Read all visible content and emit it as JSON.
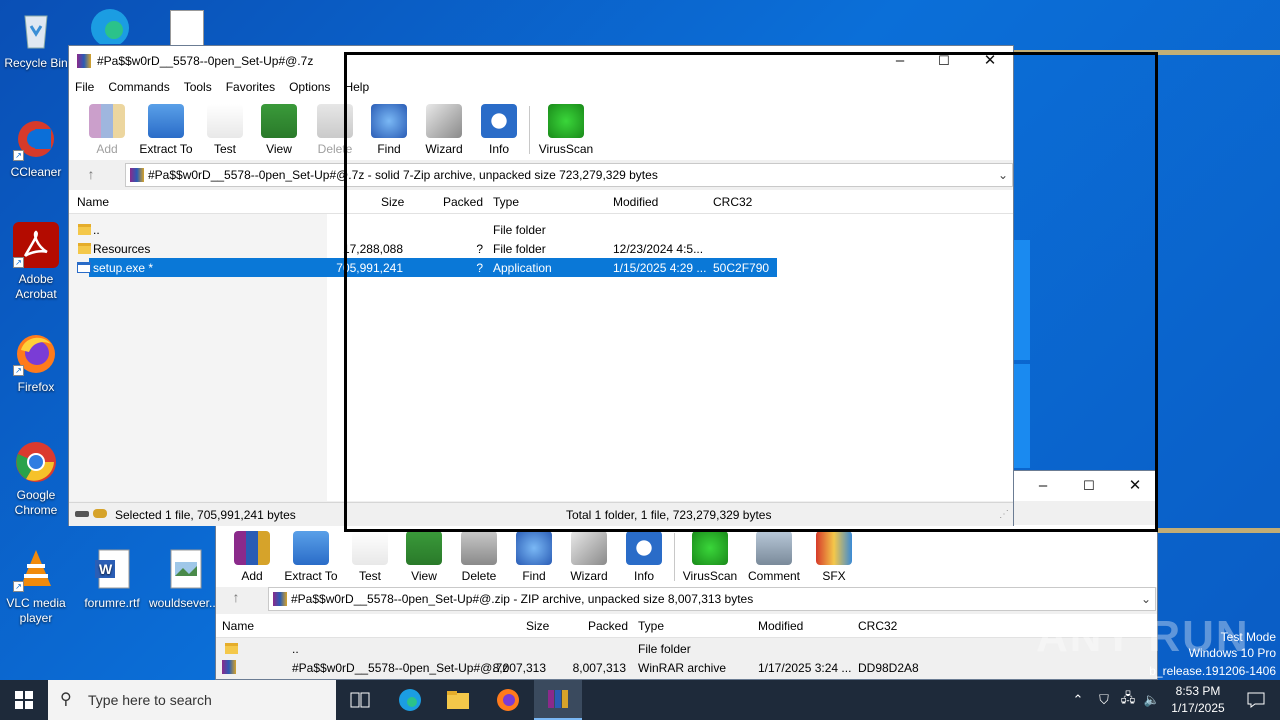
{
  "desktop": {
    "icons": [
      {
        "label": "Recycle Bin"
      },
      {
        "label": "CCleaner"
      },
      {
        "label": "Adobe Acrobat"
      },
      {
        "label": "Firefox"
      },
      {
        "label": "Google Chrome"
      },
      {
        "label": "VLC media player"
      },
      {
        "label": "forumre.rtf"
      },
      {
        "label": "wouldsever..."
      }
    ],
    "watermark": "ANY RUN",
    "test_mode": [
      "Test Mode",
      "Windows 10 Pro",
      "b_release.191206-1406"
    ]
  },
  "win7z": {
    "title": "#Pa$$w0rD__5578--0pen_Set-Up#@.7z",
    "menu": [
      "File",
      "Commands",
      "Tools",
      "Favorites",
      "Options",
      "Help"
    ],
    "toolbar": [
      {
        "label": "Add",
        "icon": "add-icon",
        "enabled": false
      },
      {
        "label": "Extract To",
        "icon": "extract-icon",
        "enabled": true
      },
      {
        "label": "Test",
        "icon": "test-icon",
        "enabled": true
      },
      {
        "label": "View",
        "icon": "view-icon",
        "enabled": true
      },
      {
        "label": "Delete",
        "icon": "delete-icon",
        "enabled": false
      },
      {
        "label": "Find",
        "icon": "find-icon",
        "enabled": true
      },
      {
        "label": "Wizard",
        "icon": "wizard-icon",
        "enabled": true
      },
      {
        "label": "Info",
        "icon": "info-icon",
        "enabled": true
      },
      {
        "label": "VirusScan",
        "icon": "virusscan-icon",
        "enabled": true
      }
    ],
    "path": "#Pa$$w0rD__5578--0pen_Set-Up#@.7z - solid 7-Zip archive, unpacked size 723,279,329 bytes",
    "columns": [
      "Name",
      "Size",
      "Packed",
      "Type",
      "Modified",
      "CRC32"
    ],
    "rows": [
      {
        "name": "..",
        "size": "",
        "packed": "",
        "type": "File folder",
        "modified": "",
        "crc": ""
      },
      {
        "name": "Resources",
        "size": "17,288,088",
        "packed": "?",
        "type": "File folder",
        "modified": "12/23/2024 4:5...",
        "crc": ""
      },
      {
        "name": "setup.exe *",
        "size": "705,991,241",
        "packed": "?",
        "type": "Application",
        "modified": "1/15/2025 4:29 ...",
        "crc": "50C2F790"
      }
    ],
    "status_left": "Selected 1 file, 705,991,241 bytes",
    "status_right": "Total 1 folder, 1 file, 723,279,329 bytes"
  },
  "winzip": {
    "toolbar": [
      {
        "label": "Add",
        "icon": "add-icon"
      },
      {
        "label": "Extract To",
        "icon": "extract-icon"
      },
      {
        "label": "Test",
        "icon": "test-icon"
      },
      {
        "label": "View",
        "icon": "view-icon"
      },
      {
        "label": "Delete",
        "icon": "delete-icon"
      },
      {
        "label": "Find",
        "icon": "find-icon"
      },
      {
        "label": "Wizard",
        "icon": "wizard-icon"
      },
      {
        "label": "Info",
        "icon": "info-icon"
      },
      {
        "label": "VirusScan",
        "icon": "virusscan-icon"
      },
      {
        "label": "Comment",
        "icon": "comment-icon"
      },
      {
        "label": "SFX",
        "icon": "sfx-icon"
      }
    ],
    "path": "#Pa$$w0rD__5578--0pen_Set-Up#@.zip - ZIP archive, unpacked size 8,007,313 bytes",
    "columns": [
      "Name",
      "Size",
      "Packed",
      "Type",
      "Modified",
      "CRC32"
    ],
    "rows": [
      {
        "name": "..",
        "size": "",
        "packed": "",
        "type": "File folder",
        "modified": "",
        "crc": ""
      },
      {
        "name": "#Pa$$w0rD__5578--0pen_Set-Up#@.7z",
        "size": "8,007,313",
        "packed": "8,007,313",
        "type": "WinRAR archive",
        "modified": "1/17/2025 3:24 ...",
        "crc": "DD98D2A8"
      }
    ]
  },
  "taskbar": {
    "search_placeholder": "Type here to search",
    "time": "8:53 PM",
    "date": "1/17/2025"
  },
  "colors": {
    "selection": "#0a78d7",
    "desktop": "#0b6fd8",
    "taskbar": "#1e2a3a"
  }
}
